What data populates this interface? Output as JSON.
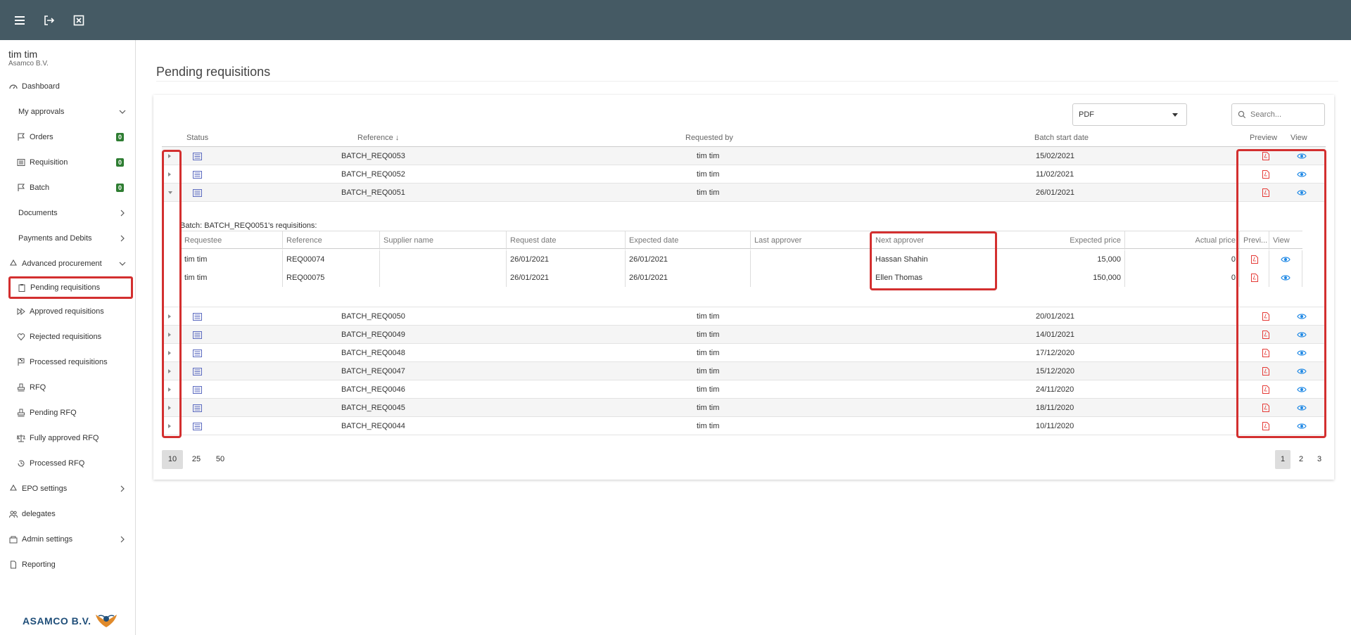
{
  "topbar": {
    "icons": [
      "menu-icon",
      "logout-icon",
      "close-box-icon"
    ]
  },
  "user": {
    "name": "tim tim",
    "company": "Asamco B.V."
  },
  "sidebar": {
    "items": [
      {
        "label": "Dashboard",
        "icon": "dashboard-icon"
      },
      {
        "label": "My approvals",
        "icon": "",
        "chevron": "down"
      },
      {
        "label": "Orders",
        "icon": "flag-icon",
        "badge": "0"
      },
      {
        "label": "Requisition",
        "icon": "list-icon",
        "badge": "0"
      },
      {
        "label": "Batch",
        "icon": "flag-icon",
        "badge": "0"
      },
      {
        "label": "Documents",
        "icon": "",
        "chevron": "right"
      },
      {
        "label": "Payments and Debits",
        "icon": "",
        "chevron": "right"
      },
      {
        "label": "Advanced procurement",
        "icon": "recycle-icon",
        "chevron": "down"
      },
      {
        "label": "Pending requisitions",
        "icon": "clipboard-icon",
        "active": true
      },
      {
        "label": "Approved requisitions",
        "icon": "fast-forward-icon"
      },
      {
        "label": "Rejected requisitions",
        "icon": "heart-broken-icon"
      },
      {
        "label": "Processed requisitions",
        "icon": "flag-checkered-icon"
      },
      {
        "label": "RFQ",
        "icon": "stamp-icon"
      },
      {
        "label": "Pending RFQ",
        "icon": "stamp-icon"
      },
      {
        "label": "Fully approved RFQ",
        "icon": "balance-icon"
      },
      {
        "label": "Processed RFQ",
        "icon": "history-icon"
      },
      {
        "label": "EPO settings",
        "icon": "recycle-icon",
        "chevron": "right"
      },
      {
        "label": "delegates",
        "icon": "users-icon"
      },
      {
        "label": "Admin settings",
        "icon": "admin-icon",
        "chevron": "right"
      },
      {
        "label": "Reporting",
        "icon": "file-icon"
      }
    ]
  },
  "logo": {
    "text": "ASAMCO B.V."
  },
  "page": {
    "title": "Pending requisitions"
  },
  "toolbar": {
    "export_format": "PDF",
    "search_placeholder": "Search..."
  },
  "table": {
    "headers": {
      "status": "Status",
      "reference": "Reference ↓",
      "requested_by": "Requested by",
      "batch_start_date": "Batch start date",
      "preview": "Preview",
      "view": "View"
    },
    "rows": [
      {
        "reference": "BATCH_REQ0053",
        "requested_by": "tim tim",
        "date": "15/02/2021"
      },
      {
        "reference": "BATCH_REQ0052",
        "requested_by": "tim tim",
        "date": "11/02/2021"
      },
      {
        "reference": "BATCH_REQ0051",
        "requested_by": "tim tim",
        "date": "26/01/2021",
        "expanded": true
      },
      {
        "reference": "BATCH_REQ0050",
        "requested_by": "tim tim",
        "date": "20/01/2021"
      },
      {
        "reference": "BATCH_REQ0049",
        "requested_by": "tim tim",
        "date": "14/01/2021"
      },
      {
        "reference": "BATCH_REQ0048",
        "requested_by": "tim tim",
        "date": "17/12/2020"
      },
      {
        "reference": "BATCH_REQ0047",
        "requested_by": "tim tim",
        "date": "15/12/2020"
      },
      {
        "reference": "BATCH_REQ0046",
        "requested_by": "tim tim",
        "date": "24/11/2020"
      },
      {
        "reference": "BATCH_REQ0045",
        "requested_by": "tim tim",
        "date": "18/11/2020"
      },
      {
        "reference": "BATCH_REQ0044",
        "requested_by": "tim tim",
        "date": "10/11/2020"
      }
    ]
  },
  "detail": {
    "title": "Batch: BATCH_REQ0051's requisitions:",
    "headers": [
      "Requestee",
      "Reference",
      "Supplier name",
      "Request date",
      "Expected date",
      "Last approver",
      "Next approver",
      "Expected price",
      "Actual price",
      "Previ...",
      "View"
    ],
    "rows": [
      {
        "requestee": "tim tim",
        "reference": "REQ00074",
        "supplier": "",
        "request_date": "26/01/2021",
        "expected_date": "26/01/2021",
        "last_approver": "",
        "next_approver": "Hassan Shahin",
        "expected_price": "15,000",
        "actual_price": "0"
      },
      {
        "requestee": "tim tim",
        "reference": "REQ00075",
        "supplier": "",
        "request_date": "26/01/2021",
        "expected_date": "26/01/2021",
        "last_approver": "",
        "next_approver": "Ellen Thomas",
        "expected_price": "150,000",
        "actual_price": "0"
      }
    ]
  },
  "pager": {
    "sizes": [
      "10",
      "25",
      "50"
    ],
    "selected_size": "10",
    "pages": [
      "1",
      "2",
      "3"
    ],
    "current_page": "1"
  },
  "colors": {
    "topbar": "#455a64",
    "highlight": "#d32f2f",
    "badge": "#2e7d32",
    "pdf": "#e53935",
    "view": "#1e88e5"
  }
}
